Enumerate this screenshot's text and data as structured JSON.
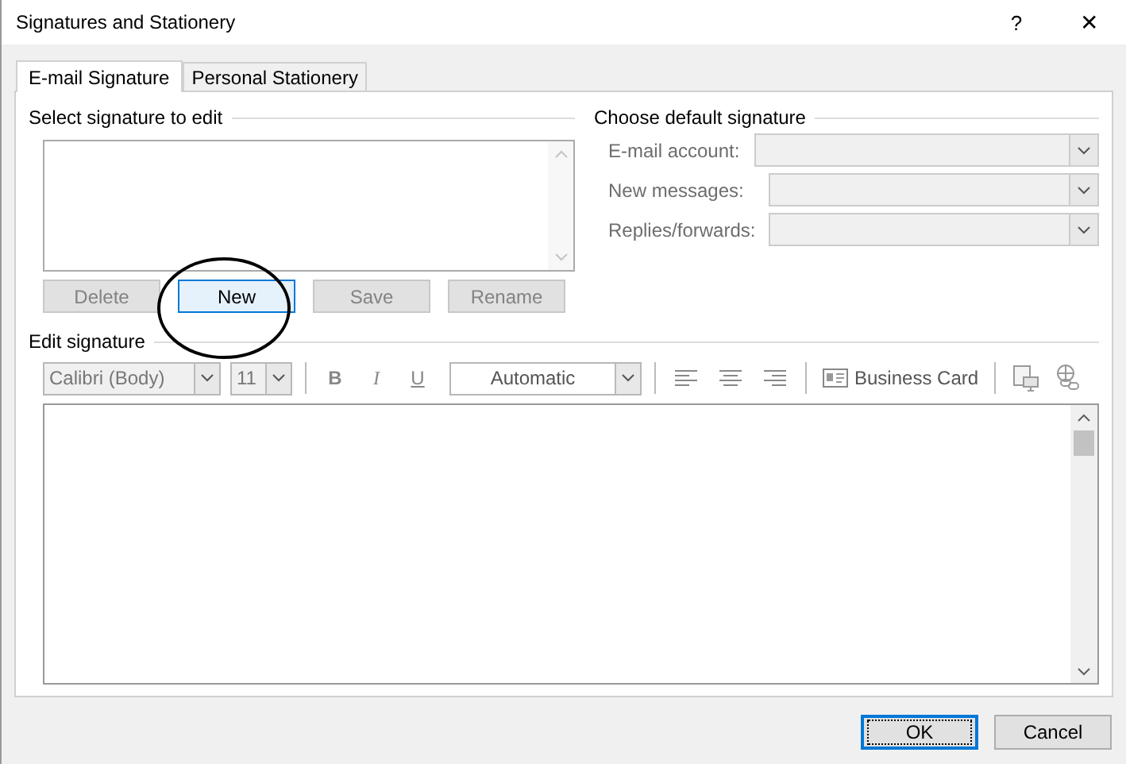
{
  "window": {
    "title": "Signatures and Stationery",
    "help": "?",
    "close": "✕"
  },
  "tabs": [
    {
      "label": "E-mail Signature",
      "selected": true
    },
    {
      "label": "Personal Stationery",
      "selected": false
    }
  ],
  "select_signature": {
    "heading": "Select signature to edit",
    "buttons": [
      {
        "label": "Delete",
        "disabled": true,
        "focused": false
      },
      {
        "label": "New",
        "disabled": false,
        "focused": true
      },
      {
        "label": "Save",
        "disabled": true,
        "focused": false
      },
      {
        "label": "Rename",
        "disabled": true,
        "focused": false
      }
    ]
  },
  "default_signature": {
    "heading": "Choose default signature",
    "fields": [
      {
        "label": "E-mail account:",
        "disabled": true
      },
      {
        "label": "New messages:",
        "disabled": true
      },
      {
        "label": "Replies/forwards:",
        "disabled": true
      }
    ]
  },
  "edit_signature": {
    "heading": "Edit signature",
    "toolbar": {
      "font": "Calibri (Body)",
      "size": "11",
      "bold": "B",
      "italic": "I",
      "underline": "U",
      "font_color_setting": "Automatic",
      "business_card": "Business Card"
    }
  },
  "buttons": [
    {
      "label": "OK",
      "focused": true
    },
    {
      "label": "Cancel",
      "focused": false
    }
  ]
}
